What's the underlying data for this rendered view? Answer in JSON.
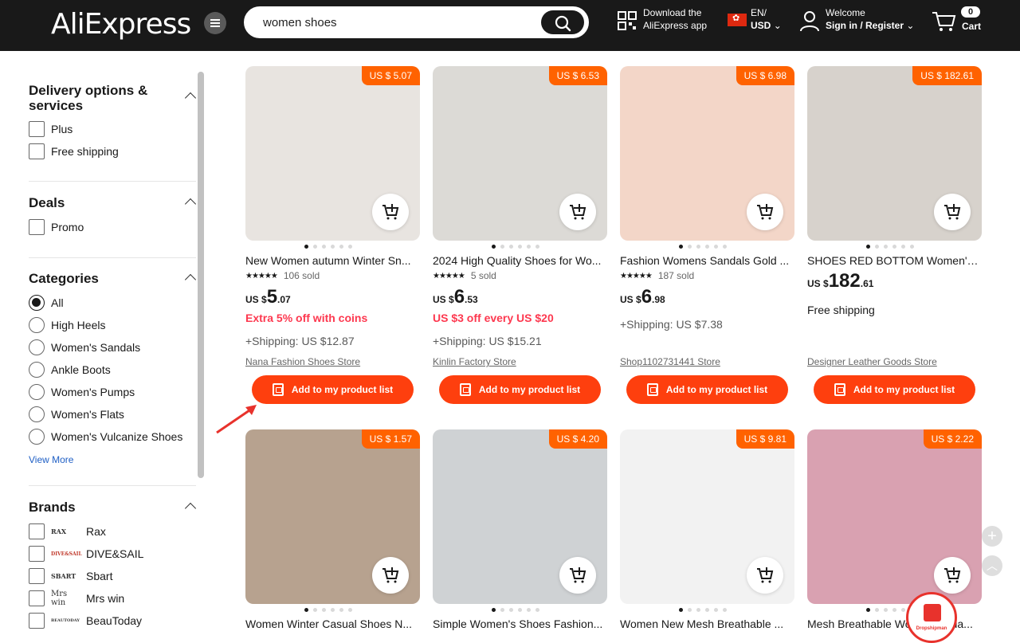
{
  "header": {
    "logo": "AliExpress",
    "search_value": "women shoes",
    "download_line1": "Download the",
    "download_line2": "AliExpress app",
    "lang": "EN/",
    "currency": "USD",
    "welcome": "Welcome",
    "signin": "Sign in / Register",
    "cart_count": "0",
    "cart_label": "Cart"
  },
  "sidebar": {
    "delivery_title": "Delivery options & services",
    "delivery": [
      "Plus",
      "Free shipping"
    ],
    "deals_title": "Deals",
    "deals": [
      "Promo"
    ],
    "categories_title": "Categories",
    "categories": [
      "All",
      "High Heels",
      "Women's Sandals",
      "Ankle Boots",
      "Women's Pumps",
      "Women's Flats",
      "Women's Vulcanize Shoes"
    ],
    "selected_category": "All",
    "view_more": "View More",
    "brands_title": "Brands",
    "brands": [
      {
        "logo": "RAX",
        "name": "Rax"
      },
      {
        "logo": "DIVE&SAIL",
        "name": "DIVE&SAIL"
      },
      {
        "logo": "SBART",
        "name": "Sbart"
      },
      {
        "logo": "Mrs win",
        "name": "Mrs win"
      },
      {
        "logo": "BEAUTODAY",
        "name": "BeauToday"
      }
    ]
  },
  "products": [
    {
      "tag": "US $ 5.07",
      "title": "New Women autumn Winter Sn...",
      "sold": "106 sold",
      "cur": "US $",
      "int": "5",
      "dec": ".07",
      "promo": "Extra 5% off with coins",
      "shipping": "+Shipping: US $12.87",
      "store": "Nana Fashion Shoes Store",
      "btn": "Add to my product list",
      "color": "#e8e4e0"
    },
    {
      "tag": "US $ 6.53",
      "title": "2024 High Quality Shoes for Wo...",
      "sold": "5 sold",
      "cur": "US $",
      "int": "6",
      "dec": ".53",
      "promo": "US $3 off every US $20",
      "shipping": "+Shipping: US $15.21",
      "store": "Kinlin Factory Store",
      "btn": "Add to my product list",
      "color": "#dcdad6"
    },
    {
      "tag": "US $ 6.98",
      "title": "Fashion Womens Sandals Gold ...",
      "sold": "187 sold",
      "cur": "US $",
      "int": "6",
      "dec": ".98",
      "promo": "",
      "shipping": "+Shipping: US $7.38",
      "store": "Shop1102731441 Store",
      "btn": "Add to my product list",
      "color": "#f3d6c8"
    },
    {
      "tag": "US $ 182.61",
      "title": "SHOES RED BOTTOM Women's ...",
      "sold": "",
      "cur": "US $",
      "int": "182",
      "dec": ".61",
      "promo": "",
      "shipping": "Free shipping",
      "store": "Designer Leather Goods Store",
      "btn": "Add to my product list",
      "color": "#d7d2cc"
    },
    {
      "tag": "US $ 1.57",
      "title": "Women Winter Casual Shoes N...",
      "color": "#b7a28f"
    },
    {
      "tag": "US $ 4.20",
      "title": "Simple Women's Shoes Fashion...",
      "color": "#cfd2d4"
    },
    {
      "tag": "US $ 9.81",
      "title": "Women New Mesh Breathable ...",
      "color": "#f2f2f2"
    },
    {
      "tag": "US $ 2.22",
      "title": "Mesh Breathable Women's Sua...",
      "color": "#d9a1b1"
    }
  ],
  "dropshipman_label": "Dropshipman",
  "colors": {
    "accent": "#fe3f0e",
    "tag": "#ff6200",
    "promo": "#fd384f",
    "header": "#191919"
  }
}
